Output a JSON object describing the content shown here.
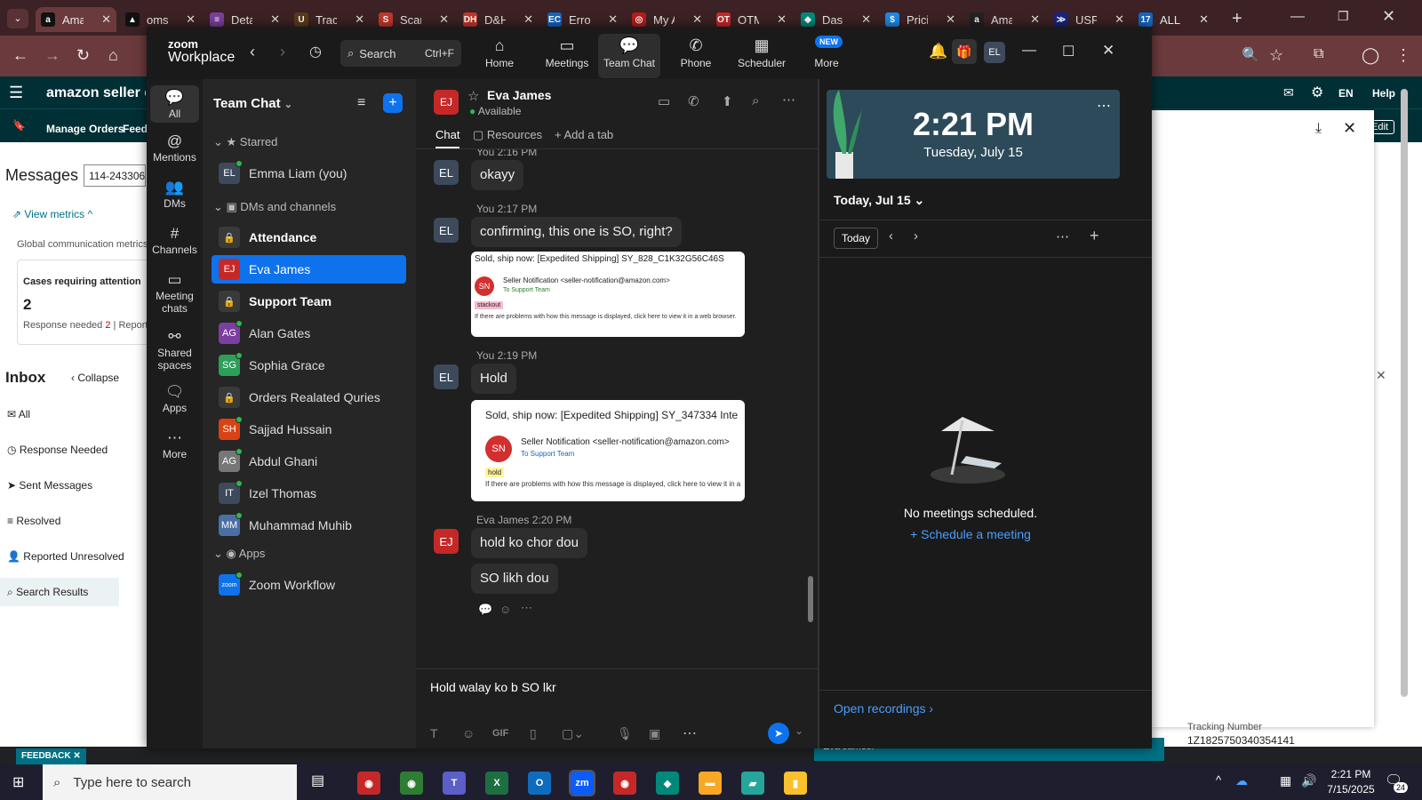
{
  "browser": {
    "tabs": [
      {
        "title": "Amazon",
        "color": "#111"
      },
      {
        "title": "oms.",
        "color": "#111"
      },
      {
        "title": "Details",
        "color": "#7b3f9a"
      },
      {
        "title": "Tracking",
        "color": "#5a3a1a"
      },
      {
        "title": "Scan",
        "color": "#c0392b"
      },
      {
        "title": "D&H",
        "color": "#c0392b"
      },
      {
        "title": "Error",
        "color": "#1565c0"
      },
      {
        "title": "My A",
        "color": "#b71c1c"
      },
      {
        "title": "OTM",
        "color": "#c62828"
      },
      {
        "title": "Dash",
        "color": "#00897b"
      },
      {
        "title": "Pricing",
        "color": "#1e88e5"
      },
      {
        "title": "Amazon",
        "color": "#222"
      },
      {
        "title": "USPS",
        "color": "#1a237e"
      },
      {
        "title": "ALL",
        "color": "#1565c0"
      }
    ],
    "tab_fav_letters": [
      "a",
      "▲",
      "≡",
      "U",
      "S",
      "DH",
      "EC",
      "◎",
      "OT",
      "◆",
      "$",
      "a",
      "≫",
      "17"
    ]
  },
  "amazon": {
    "logo": "amazon seller cent",
    "manage_orders": "Manage Orders",
    "feedback_nav": "Feedb",
    "messages": "Messages",
    "search_value": "114-243306",
    "view_metrics": "View metrics",
    "global_comm": "Global communication metrics",
    "cases_title": "Cases requiring attention",
    "cases_count": "2",
    "response_needed": "Response needed",
    "response_count": "2",
    "report": "Report",
    "inbox": "Inbox",
    "collapse": "Collapse",
    "folders": [
      "All",
      "Response Needed",
      "Sent Messages",
      "Resolved",
      "Reported Unresolved",
      "Search Results"
    ],
    "feedback": "FEEDBACK",
    "lang": "EN",
    "help": "Help",
    "edit": "Edit",
    "tracking_label": "Tracking Number",
    "tracking_number": "1Z1825750340354141",
    "eva_footer": "Eva James."
  },
  "zoom": {
    "brand_line1": "zoom",
    "brand_line2": "Workplace",
    "search_placeholder": "Search",
    "search_shortcut": "Ctrl+F",
    "nav": [
      "Home",
      "Meetings",
      "Team Chat",
      "Phone",
      "Scheduler",
      "More"
    ],
    "new_badge": "NEW",
    "user_initials": "EL",
    "rail": [
      "All",
      "Mentions",
      "DMs",
      "Channels",
      "Meeting chats",
      "Shared spaces",
      "Apps",
      "More"
    ],
    "list_title": "Team Chat",
    "sections": {
      "starred": "Starred",
      "dms": "DMs and channels",
      "apps": "Apps"
    },
    "starred": [
      {
        "name": "Emma Liam (you)",
        "initials": "EL",
        "color": "#3d4a5c"
      }
    ],
    "channels": [
      {
        "name": "Attendance",
        "initials": "🔒",
        "color": "#3a3a3a",
        "bold": true
      },
      {
        "name": "Eva James",
        "initials": "EJ",
        "color": "#c62828",
        "selected": true
      },
      {
        "name": "Support Team",
        "initials": "🔒",
        "color": "#3a3a3a",
        "bold": true
      },
      {
        "name": "Alan Gates",
        "initials": "AG",
        "color": "#7b3fa0"
      },
      {
        "name": "Sophia Grace",
        "initials": "SG",
        "color": "#2e9e5b"
      },
      {
        "name": "Orders Realated Quries",
        "initials": "🔒",
        "color": "#3a3a3a"
      },
      {
        "name": "Sajjad Hussain",
        "initials": "SH",
        "color": "#d84315"
      },
      {
        "name": "Abdul Ghani",
        "initials": "AG",
        "color": "#777"
      },
      {
        "name": "Izel Thomas",
        "initials": "IT",
        "color": "#3d4a5c"
      },
      {
        "name": "Muhammad Muhib",
        "initials": "MM",
        "color": "#4a6fa5"
      }
    ],
    "apps": [
      {
        "name": "Zoom Workflow",
        "initials": "zoom",
        "color": "#0e72ed"
      }
    ],
    "chat": {
      "contact": "Eva James",
      "contact_initials": "EJ",
      "status": "Available",
      "tabs": [
        "Chat",
        "Resources",
        "Add a tab"
      ],
      "messages": [
        {
          "meta": "You 2:16 PM",
          "text": "okayy"
        },
        {
          "meta": "You 2:17 PM",
          "text": "confirming, this one is SO, right?"
        },
        {
          "meta": "You 2:19 PM",
          "text": "Hold"
        },
        {
          "meta": "Eva James 2:20 PM",
          "text": "hold ko chor dou"
        },
        {
          "meta": "",
          "text": "SO likh dou"
        }
      ],
      "image1": {
        "subject": "Sold, ship now: [Expedited Shipping] SY_828_C1K32G56C46S",
        "sender": "Seller Notification <seller-notification@amazon.com>",
        "to": "To  Support Team",
        "tag": "stackout",
        "note": "If there are problems with how this message is displayed, click here to view it in a web browser."
      },
      "image2": {
        "subject": "Sold, ship now: [Expedited Shipping] SY_347334 Inte",
        "sender": "Seller Notification <seller-notification@amazon.com>",
        "to": "To  Support Team",
        "tag": "hold",
        "note": "If there are problems with how this message is displayed, click here to view it in a"
      },
      "compose_text": "Hold walay ko b SO lkr",
      "toolbar_gif": "GIF"
    },
    "calendar": {
      "time": "2:21 PM",
      "date": "Tuesday, July 15",
      "today_label": "Today, Jul 15",
      "today_btn": "Today",
      "empty": "No meetings scheduled.",
      "schedule": "Schedule a meeting",
      "recordings": "Open recordings"
    }
  },
  "taskbar": {
    "search": "Type here to search",
    "time": "2:21 PM",
    "date": "7/15/2025",
    "notif_count": "24"
  }
}
